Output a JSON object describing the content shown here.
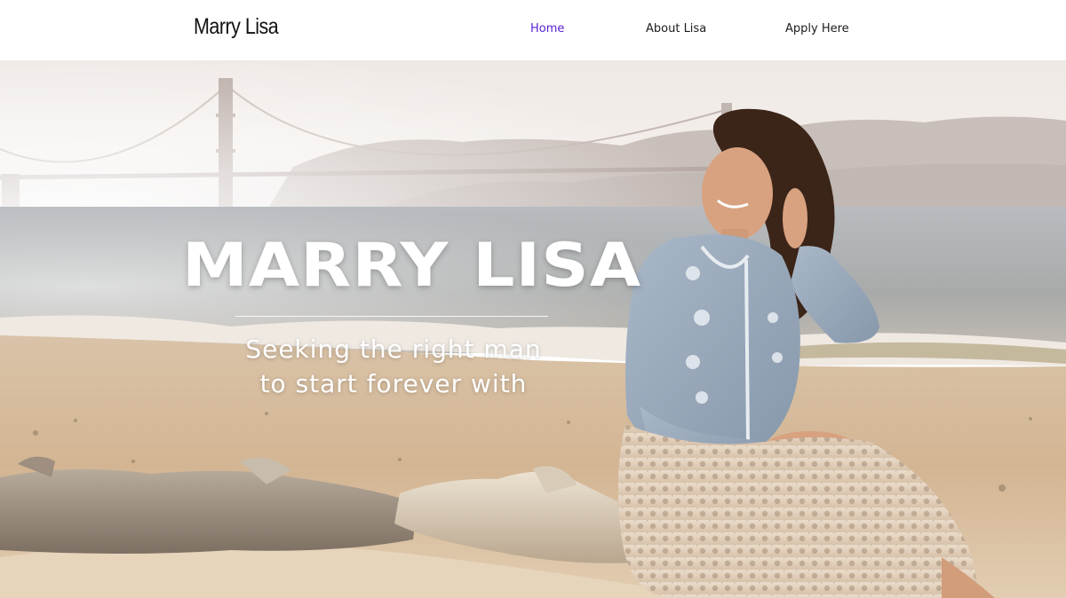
{
  "header": {
    "logo": "Marry Lisa",
    "nav": [
      {
        "label": "Home",
        "active": true
      },
      {
        "label": "About Lisa",
        "active": false
      },
      {
        "label": "Apply Here",
        "active": false
      }
    ]
  },
  "hero": {
    "title": "MARRY LISA",
    "subtitle_line1": "Seeking the right man",
    "subtitle_line2": "to start forever with"
  },
  "colors": {
    "nav_active": "#5a21d6",
    "nav_default": "#1c1c1c",
    "header_bg": "#ffffff"
  }
}
